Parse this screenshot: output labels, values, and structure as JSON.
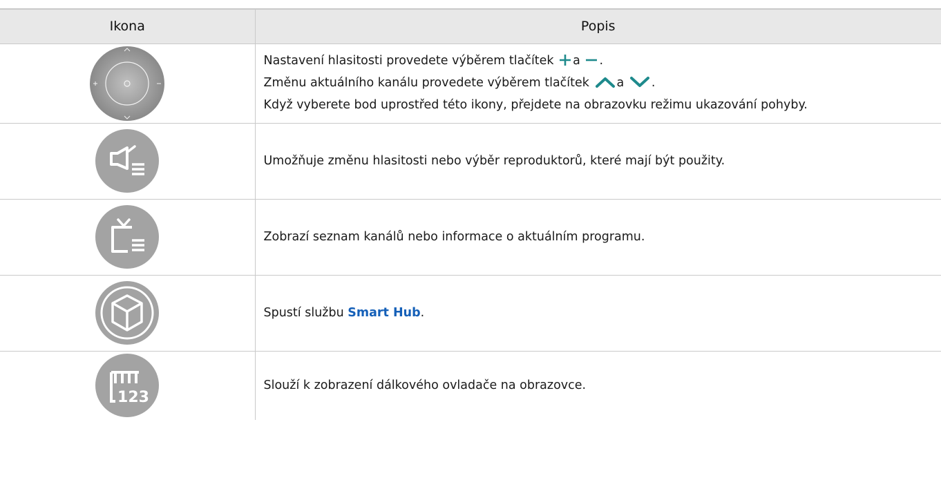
{
  "table": {
    "headers": {
      "icon": "Ikona",
      "description": "Popis"
    },
    "rows": [
      {
        "icon": "navigation-dial-icon",
        "dial_labels": {
          "up": "^",
          "down": "v",
          "plus": "+",
          "minus": "−",
          "center": "○"
        },
        "lines": [
          {
            "before": "Nastavení hlasitosti provedete výběrem tlačítek",
            "mid": "a",
            "after": "."
          },
          {
            "before": "Změnu aktuálního kanálu provedete výběrem tlačítek",
            "mid": "a",
            "after": "."
          },
          {
            "text": "Když vyberete bod uprostřed této ikony, přejdete na obrazovku režimu ukazování pohyby."
          }
        ]
      },
      {
        "icon": "speaker-settings-icon",
        "text": "Umožňuje změnu hlasitosti nebo výběr reproduktorů, které mají být použity."
      },
      {
        "icon": "channel-list-icon",
        "text": "Zobrazí seznam kanálů nebo informace o aktuálním programu."
      },
      {
        "icon": "smart-hub-icon",
        "before": "Spustí službu",
        "highlight": "Smart Hub",
        "after": "."
      },
      {
        "icon": "virtual-remote-icon",
        "icon_text": "123",
        "text": "Slouží k zobrazení dálkového ovladače na obrazovce."
      }
    ]
  },
  "colors": {
    "header_bg": "#e8e8e8",
    "icon_gray": "#a3a3a3",
    "icon_teal": "#1e8a8c",
    "highlight_blue": "#1560b8",
    "border": "#c9c9c9"
  }
}
